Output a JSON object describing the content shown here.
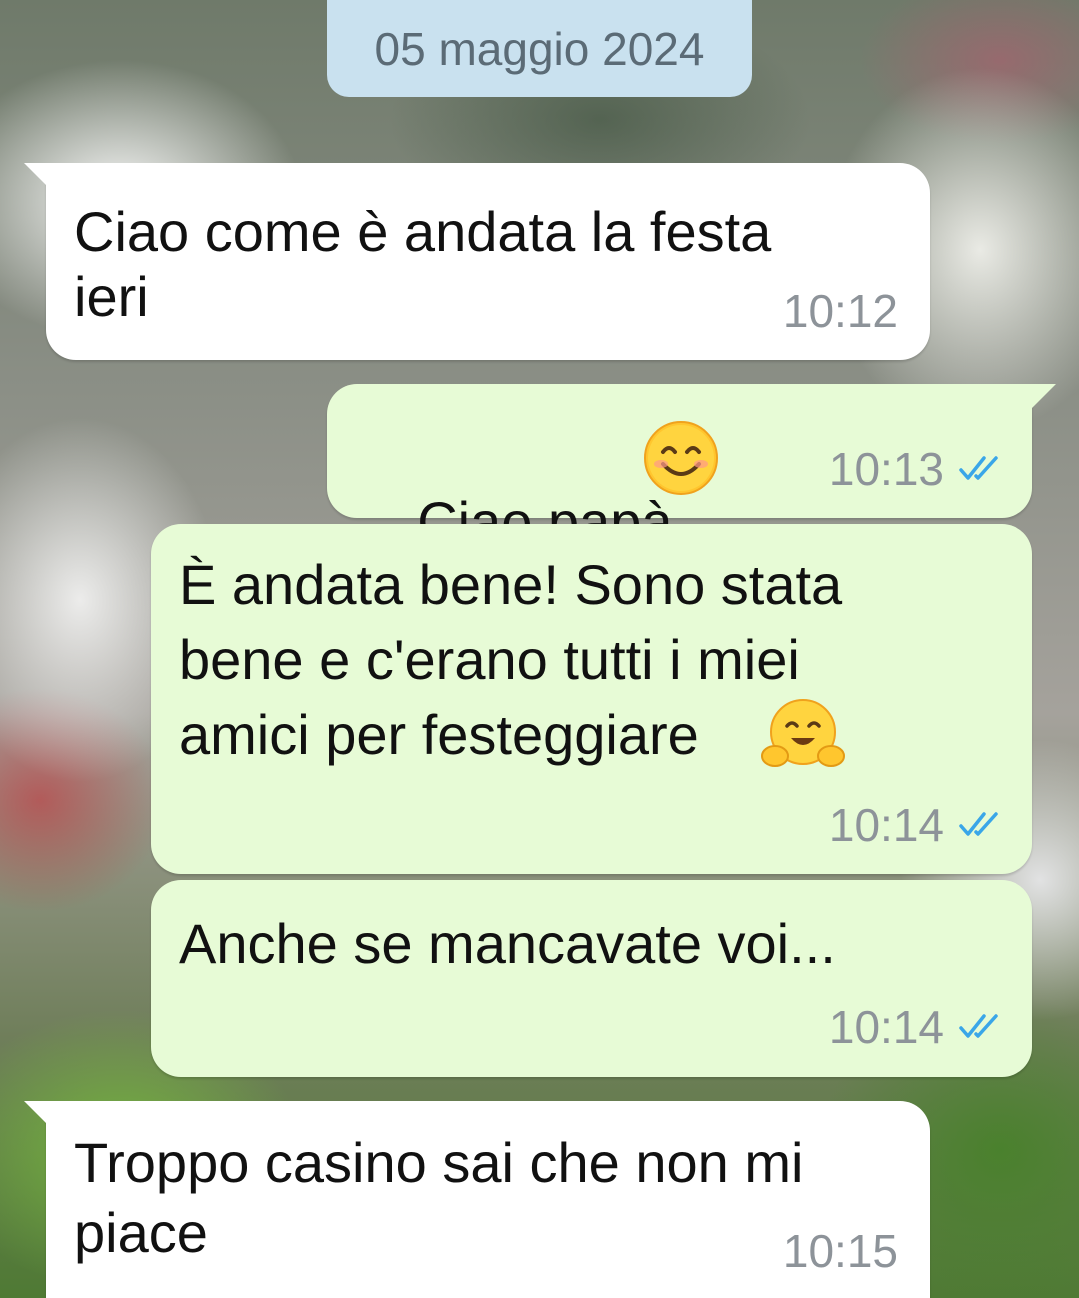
{
  "date_chip": {
    "label": "05 maggio 2024"
  },
  "messages": [
    {
      "direction": "incoming",
      "text_line1": "Ciao come è andata la festa",
      "text_line2": "ieri",
      "time": "10:12"
    },
    {
      "direction": "outgoing",
      "text": "Ciao papà",
      "emoji": "smiling-face-icon",
      "time": "10:13",
      "status": "read"
    },
    {
      "direction": "outgoing",
      "text_line1": "È andata bene! Sono stata",
      "text_line2": "bene e c'erano tutti i miei",
      "text_line3": "amici per festeggiare",
      "emoji": "hugging-face-icon",
      "time": "10:14",
      "status": "read"
    },
    {
      "direction": "outgoing",
      "text": "Anche se mancavate voi...",
      "time": "10:14",
      "status": "read"
    },
    {
      "direction": "incoming",
      "text_line1": "Troppo casino sai che non mi",
      "text_line2": "piace",
      "time": "10:15"
    }
  ],
  "colors": {
    "incoming_bubble": "#ffffff",
    "outgoing_bubble": "#e7fbd6",
    "date_chip": "#c9e1ef",
    "read_ticks": "#3aa6e8",
    "time_text": "#8d9399"
  }
}
